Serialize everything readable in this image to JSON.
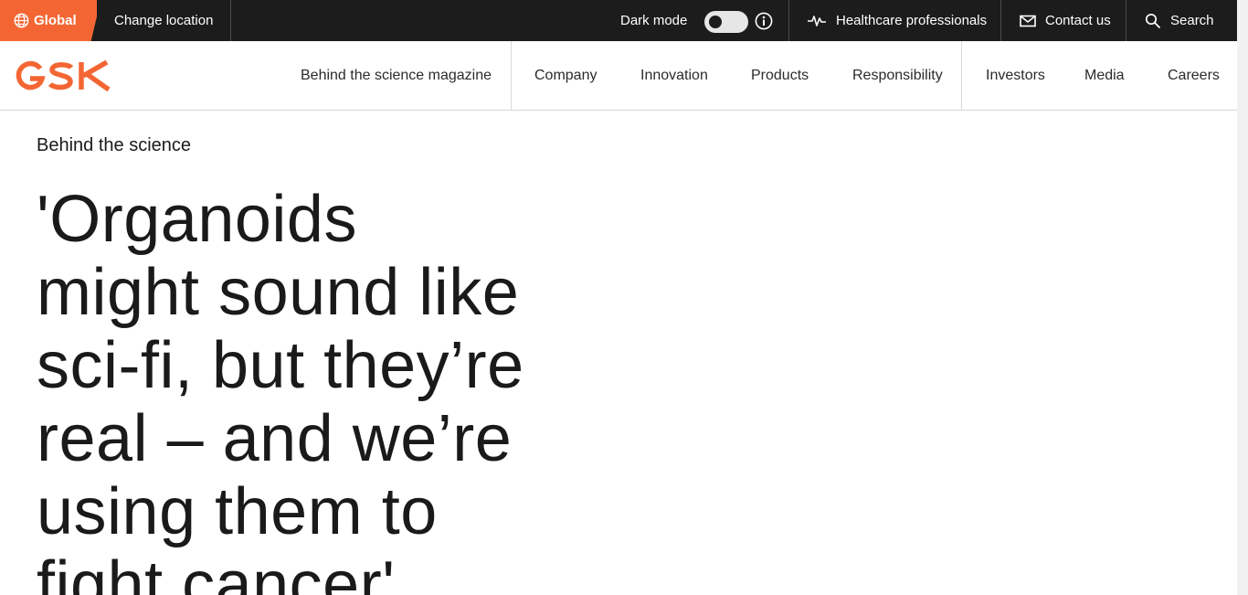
{
  "topbar": {
    "global_label": "Global",
    "change_location": "Change location",
    "dark_mode_label": "Dark mode",
    "dark_mode_on": false,
    "hcp_label": "Healthcare professionals",
    "contact_label": "Contact us",
    "search_label": "Search"
  },
  "brand": {
    "logo_text": "GSK",
    "accent_color": "#f36633"
  },
  "nav": {
    "items": [
      {
        "label": "Behind the science magazine"
      },
      {
        "label": "Company"
      },
      {
        "label": "Innovation"
      },
      {
        "label": "Products"
      },
      {
        "label": "Responsibility"
      },
      {
        "label": "Investors"
      },
      {
        "label": "Media"
      },
      {
        "label": "Careers"
      }
    ]
  },
  "article": {
    "eyebrow": "Behind the science",
    "headline_lines": [
      "'Organoids",
      "might sound like",
      "sci-fi, but they’re",
      "real – and we’re",
      "using them to",
      "fight cancer'"
    ]
  }
}
